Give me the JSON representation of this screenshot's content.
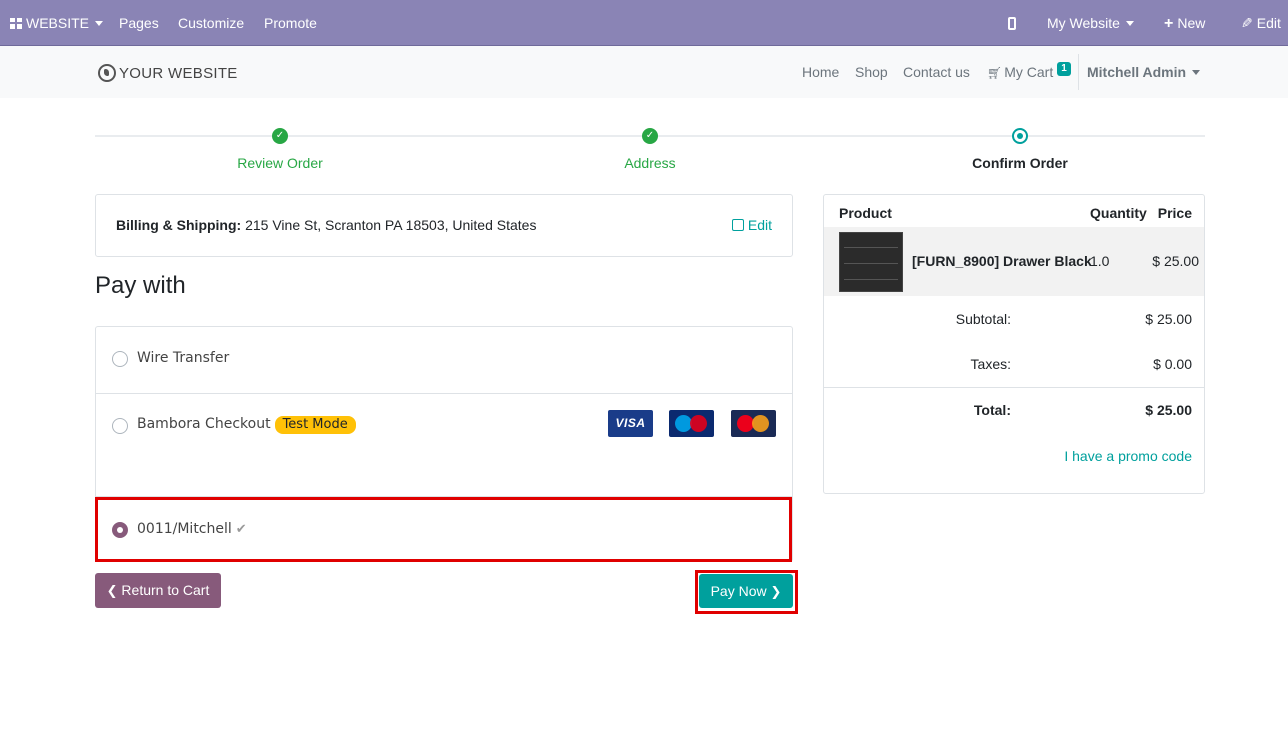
{
  "admin_bar": {
    "website_menu": "WEBSITE",
    "pages": "Pages",
    "customize": "Customize",
    "promote": "Promote",
    "my_website": "My Website",
    "new": "New",
    "edit": "Edit"
  },
  "site_nav": {
    "logo_text": "YOUR WEBSITE",
    "home": "Home",
    "shop": "Shop",
    "contact": "Contact us",
    "cart": "My Cart",
    "cart_count": "1",
    "user": "Mitchell Admin"
  },
  "wizard": {
    "steps": [
      {
        "label": "Review Order",
        "state": "done"
      },
      {
        "label": "Address",
        "state": "done"
      },
      {
        "label": "Confirm Order",
        "state": "current"
      }
    ]
  },
  "billing": {
    "label": "Billing & Shipping:",
    "address": "215 Vine St, Scranton PA 18503, United States",
    "edit": "Edit"
  },
  "pay_with": {
    "title": "Pay with",
    "options": [
      {
        "label": "Wire Transfer",
        "selected": false
      },
      {
        "label": "Bambora Checkout",
        "badge": "Test Mode",
        "selected": false,
        "card_logos": [
          "VISA",
          "Maestro",
          "MasterCard"
        ]
      },
      {
        "label": "0011/Mitchell",
        "selected": true,
        "icon": "check-icon"
      }
    ]
  },
  "buttons": {
    "return_to_cart": "Return to Cart",
    "pay_now": "Pay Now"
  },
  "summary": {
    "headers": {
      "product": "Product",
      "quantity": "Quantity",
      "price": "Price"
    },
    "item": {
      "name": "[FURN_8900] Drawer Black",
      "quantity": "1.0",
      "price": "$ 25.00"
    },
    "subtotal_label": "Subtotal:",
    "subtotal": "$ 25.00",
    "taxes_label": "Taxes:",
    "taxes": "$ 0.00",
    "total_label": "Total:",
    "total": "$ 25.00",
    "promo": "I have a promo code"
  },
  "colors": {
    "admin_bar": "#8a84b5",
    "primary": "#875a7b",
    "accent": "#00a09d",
    "success": "#28a745",
    "highlight": "#e00000"
  }
}
